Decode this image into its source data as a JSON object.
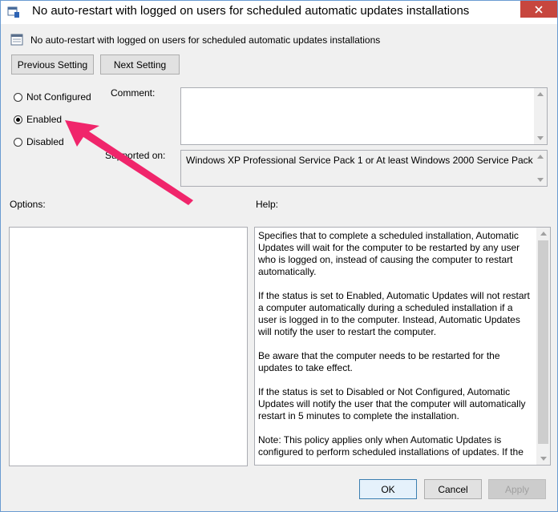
{
  "window": {
    "title": "No auto-restart with logged on users for scheduled automatic updates installations"
  },
  "header": {
    "policy_name": "No auto-restart with logged on users for scheduled automatic updates installations"
  },
  "nav": {
    "previous_label": "Previous Setting",
    "next_label": "Next Setting"
  },
  "state": {
    "options": [
      {
        "label": "Not Configured",
        "checked": false
      },
      {
        "label": "Enabled",
        "checked": true
      },
      {
        "label": "Disabled",
        "checked": false
      }
    ]
  },
  "comment": {
    "label": "Comment:",
    "value": ""
  },
  "supported": {
    "label": "Supported on:",
    "value": "Windows XP Professional Service Pack 1 or At least Windows 2000 Service Pack 3"
  },
  "options_panel": {
    "label": "Options:"
  },
  "help": {
    "label": "Help:",
    "paragraphs": [
      "Specifies that to complete a scheduled installation, Automatic Updates will wait for the computer to be restarted by any user who is logged on, instead of causing the computer to restart automatically.",
      "If the status is set to Enabled, Automatic Updates will not restart a computer automatically during a scheduled installation if a user is logged in to the computer. Instead, Automatic Updates will notify the user to restart the computer.",
      "Be aware that the computer needs to be restarted for the updates to take effect.",
      "If the status is set to Disabled or Not Configured, Automatic Updates will notify the user that the computer will automatically restart in 5 minutes to complete the installation.",
      "Note: This policy applies only when Automatic Updates is configured to perform scheduled installations of updates. If the"
    ]
  },
  "footer": {
    "ok_label": "OK",
    "cancel_label": "Cancel",
    "apply_label": "Apply"
  },
  "colors": {
    "annotation_arrow": "#f0256b",
    "close_button": "#c7463e"
  }
}
